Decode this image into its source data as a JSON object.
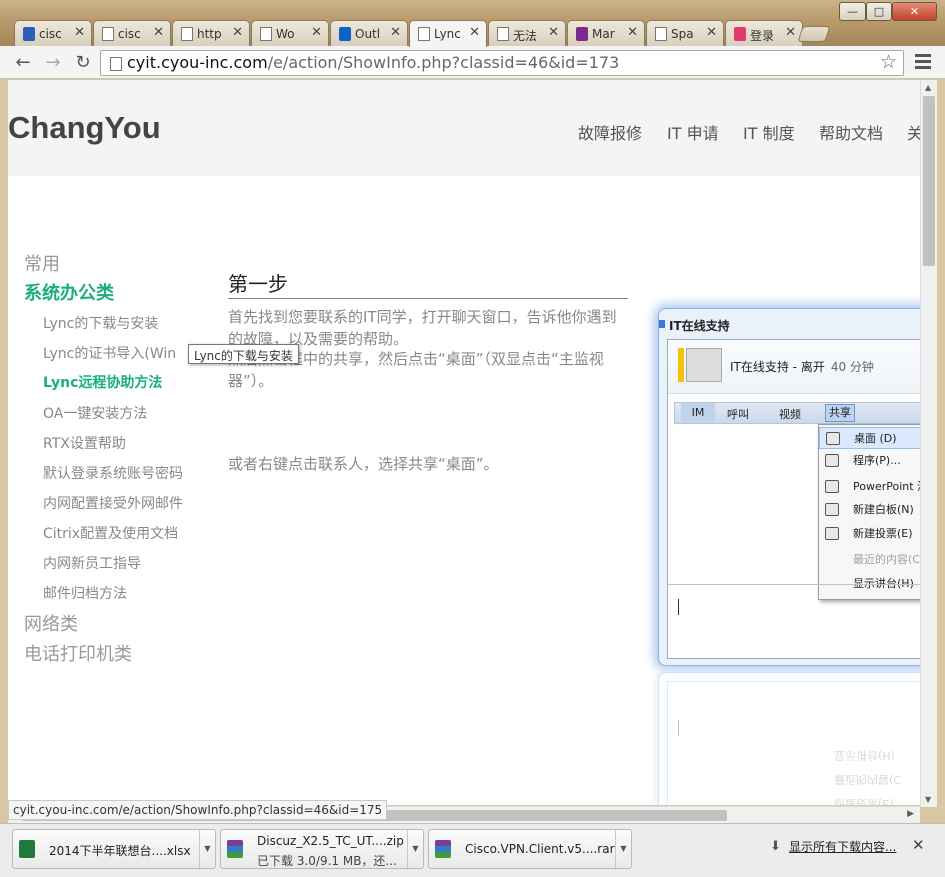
{
  "window": {
    "controls": {
      "minimize": "—",
      "maximize": "□",
      "close": "✕"
    }
  },
  "tabs": [
    {
      "label": "cisc",
      "icon": "paw-icon"
    },
    {
      "label": "cisc",
      "icon": "page-icon"
    },
    {
      "label": "http",
      "icon": "page-icon"
    },
    {
      "label": "Wo",
      "icon": "page-icon"
    },
    {
      "label": "Outl",
      "icon": "outlook-icon"
    },
    {
      "label": "Lync",
      "icon": "page-icon",
      "active": true
    },
    {
      "label": "无法",
      "icon": "page-icon"
    },
    {
      "label": "Mar",
      "icon": "m-logo-icon"
    },
    {
      "label": "Spa",
      "icon": "page-icon"
    },
    {
      "label": "登录",
      "icon": "puzzle-icon"
    }
  ],
  "tab_close_glyph": "✕",
  "toolbar": {
    "back": "←",
    "forward": "→",
    "reload": "↻",
    "url_host": "cyit.cyou-inc.com",
    "url_path": "/e/action/ShowInfo.php?classid=46&id=173",
    "star": "☆"
  },
  "site": {
    "logo": "ChangYou",
    "nav": [
      "故障报修",
      "IT 申请",
      "IT 制度",
      "帮助文档",
      "关"
    ]
  },
  "sidebar": {
    "categories": [
      {
        "label": "常用"
      },
      {
        "label": "系统办公类",
        "active": true
      },
      {
        "label": "网络类"
      },
      {
        "label": "电话打印机类"
      }
    ],
    "items": [
      "Lync的下载与安装",
      "Lync的证书导入(Win",
      "Lync远程协助方法",
      "OA一键安装方法",
      "RTX设置帮助",
      "默认登录系统账号密码",
      "内网配置接受外网邮件",
      "Citrix配置及使用文档",
      "内网新员工指导",
      "邮件归档方法"
    ],
    "active_item": 2
  },
  "tooltip": "Lync的下载与安装",
  "content": {
    "step_title": "第一步",
    "para1": "首先找到您要联系的IT同学，打开聊天窗口，告诉他你遇到的故障，以及需要的帮助。",
    "para2_prefix": "然后点击",
    "para2": "框中的共享，然后点击“桌面”（双显点击“主监视器”）。",
    "para3": "或者右键点击联系人，选择共享“桌面”。"
  },
  "screenshot": {
    "window_title": "IT在线支持",
    "contact_name": "IT在线支持 - 离开",
    "contact_time": "40 分钟",
    "tabs": [
      "IM",
      "呼叫",
      "视频",
      "共享"
    ],
    "menu": [
      {
        "label": "桌面 (D)",
        "highlight": true,
        "icon": "desktop-icon"
      },
      {
        "label": "程序(P)...",
        "icon": "program-icon"
      },
      {
        "label": "PowerPoint 演",
        "icon": "powerpoint-icon"
      },
      {
        "label": "新建白板(N)",
        "icon": "whiteboard-icon"
      },
      {
        "label": "新建投票(E)",
        "icon": "poll-icon"
      },
      {
        "label": "最近的内容(C",
        "disabled": true
      },
      {
        "label": "显示讲台(H)",
        "icon": "stage-icon"
      }
    ],
    "reflection": [
      "显示讲台(H)",
      "最近的内容(C",
      "新建投票(E)"
    ]
  },
  "statusbar": "cyit.cyou-inc.com/e/action/ShowInfo.php?classid=46&id=175",
  "downloads": [
    {
      "name": "2014下半年联想台....xlsx",
      "status": "",
      "icon": "excel-icon"
    },
    {
      "name": "Discuz_X2.5_TC_UT....zip",
      "status": "已下载 3.0/9.1 MB，还...",
      "icon": "archive-icon"
    },
    {
      "name": "Cisco.VPN.Client.v5....rar",
      "status": "",
      "icon": "archive-icon"
    }
  ],
  "shelf": {
    "show_all": "显示所有下载内容...",
    "close": "✕"
  },
  "colors": {
    "accent": "#1aaf7c",
    "text_muted": "#888888"
  }
}
